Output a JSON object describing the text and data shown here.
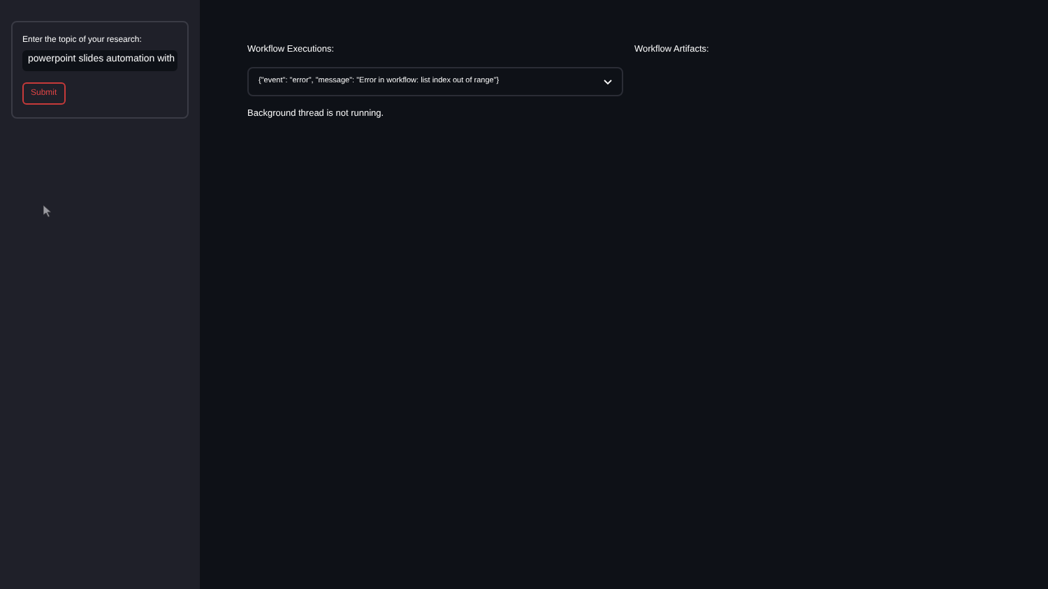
{
  "sidebar": {
    "form": {
      "label": "Enter the topic of your research:",
      "value": "powerpoint slides automation with",
      "button": "Submit"
    }
  },
  "main": {
    "executions": {
      "label": "Workflow Executions:",
      "selected_value": "{\"event\": \"error\", \"message\": \"Error in workflow: list index out of range\"}",
      "status": "Background thread is not running."
    },
    "artifacts": {
      "label": "Workflow Artifacts:"
    }
  }
}
